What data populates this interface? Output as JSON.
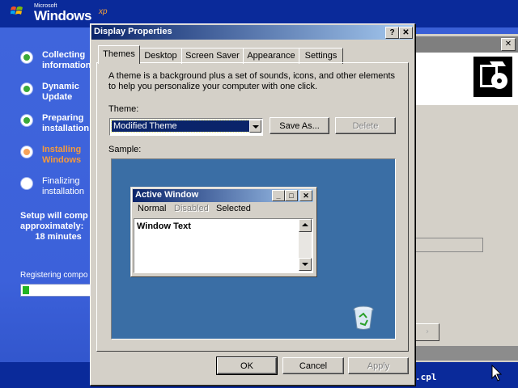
{
  "setup": {
    "logo_small": "Microsoft",
    "logo_main": "Windows",
    "logo_xp": "xp",
    "steps": [
      {
        "label": "Collecting\ninformation",
        "state": "done"
      },
      {
        "label": "Dynamic\nUpdate",
        "state": "done"
      },
      {
        "label": "Preparing\ninstallation",
        "state": "done"
      },
      {
        "label": "Installing\nWindows",
        "state": "current"
      },
      {
        "label": "Finalizing\ninstallation",
        "state": "future"
      }
    ],
    "time_text": "Setup will comp\napproximately:\n      18 minutes",
    "registering_text": "Registering compo",
    "progress_fraction": 0.1,
    "console_text": ".cpl"
  },
  "dialog": {
    "title": "Display Properties",
    "help_label": "?",
    "close_label": "✕",
    "tabs": [
      {
        "label": "Themes",
        "active": true
      },
      {
        "label": "Desktop",
        "active": false
      },
      {
        "label": "Screen Saver",
        "active": false
      },
      {
        "label": "Appearance",
        "active": false
      },
      {
        "label": "Settings",
        "active": false
      }
    ],
    "description": "A theme is a background plus a set of sounds, icons, and other elements to help you personalize your computer with one click.",
    "theme_label": "Theme:",
    "theme_value": "Modified Theme",
    "save_as_label": "Save As...",
    "delete_label": "Delete",
    "sample_label": "Sample:",
    "sample": {
      "window_title": "Active Window",
      "menu_normal": "Normal",
      "menu_disabled": "Disabled",
      "menu_selected": "Selected",
      "window_text": "Window Text"
    },
    "ok_label": "OK",
    "cancel_label": "Cancel",
    "apply_label": "Apply"
  },
  "colors": {
    "setup_blue": "#3a5fd6",
    "titlebar_start": "#0a246a",
    "titlebar_end": "#a6caf0",
    "dialog_face": "#d4d0c8",
    "sample_desktop": "#3a6ea5",
    "current_step": "#f59a3d",
    "progress_green": "#23b423"
  },
  "icons": [
    "windows-flag-icon",
    "recycle-bin-icon",
    "mouse-cursor-icon",
    "display-properties-icon"
  ]
}
